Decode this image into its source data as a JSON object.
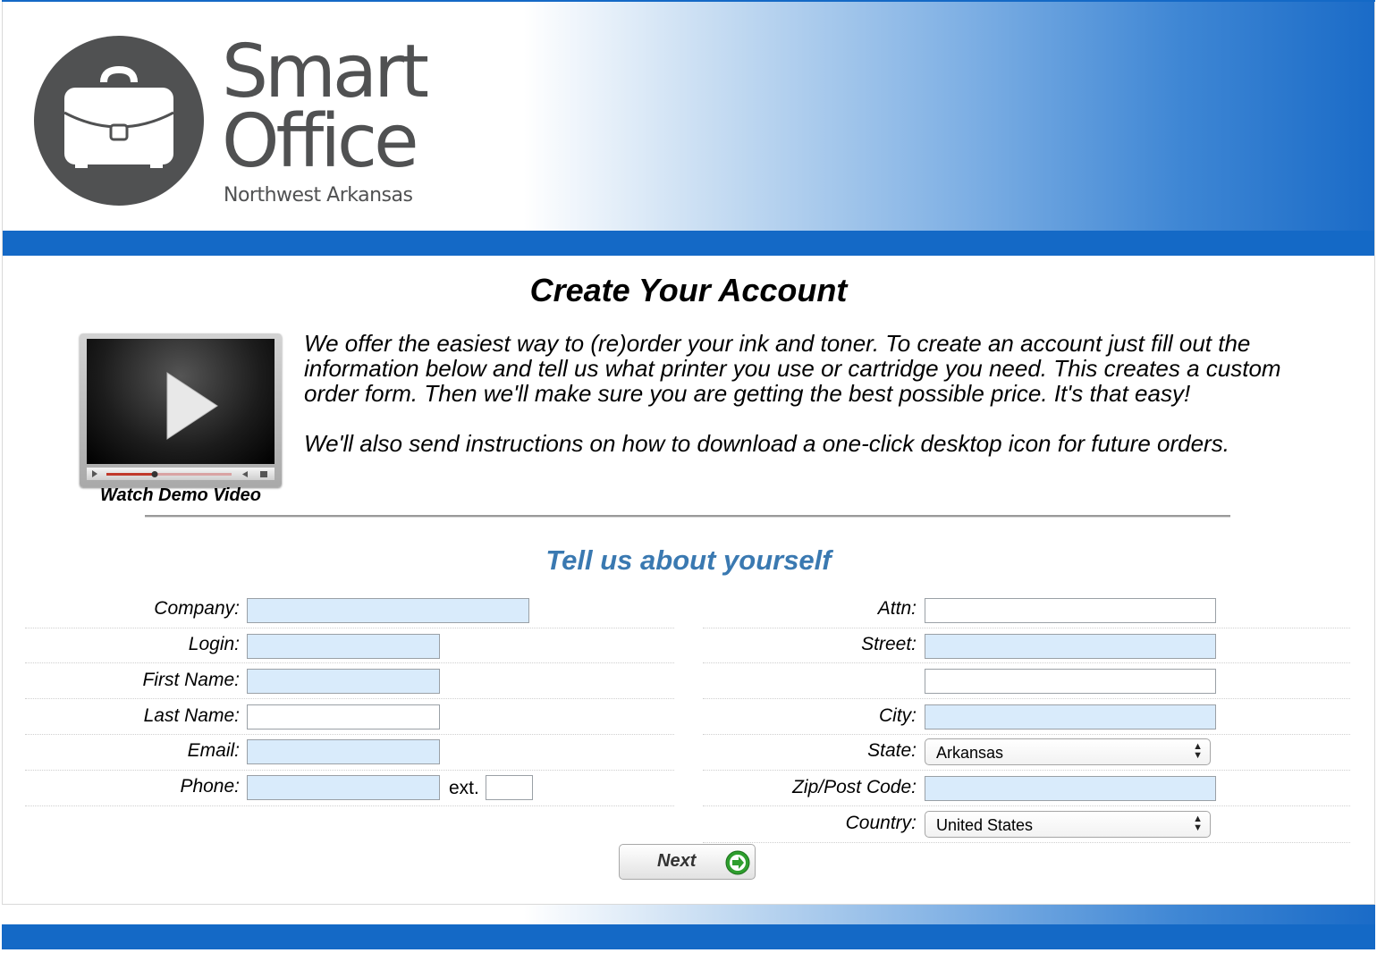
{
  "brand": {
    "name_line1": "Smart",
    "name_line2": "Office",
    "subtitle": "Northwest Arkansas",
    "accent_color": "#1469c6",
    "logo_icon": "briefcase-icon"
  },
  "page": {
    "title": "Create Your Account",
    "intro_paragraph_1": "We offer the easiest way to (re)order your ink and toner. To create an account just fill out the information below and tell us what printer you use or cartridge you need. This creates a custom order form. Then we'll make sure you are getting the best possible price. It's that easy!",
    "intro_paragraph_2": "We'll also send instructions on how to download a one-click desktop icon for future orders.",
    "video_caption": "Watch Demo Video",
    "section_title": "Tell us about yourself",
    "section_title_color": "#3a79b1"
  },
  "form": {
    "company_label": "Company:",
    "login_label": "Login:",
    "first_name_label": "First Name:",
    "last_name_label": "Last Name:",
    "email_label": "Email:",
    "phone_label": "Phone:",
    "ext_label": "ext.",
    "attn_label": "Attn:",
    "street_label": "Street:",
    "city_label": "City:",
    "state_label": "State:",
    "state_value": "Arkansas",
    "zip_label": "Zip/Post Code:",
    "country_label": "Country:",
    "country_value": "United States",
    "required_field_color": "#d9ebfb",
    "next_label": "Next"
  }
}
